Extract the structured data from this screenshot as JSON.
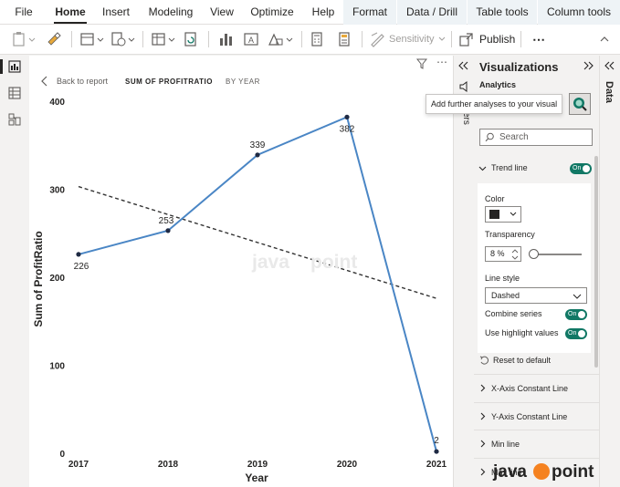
{
  "menu": {
    "items": [
      "File",
      "Home",
      "Insert",
      "Modeling",
      "View",
      "Optimize",
      "Help"
    ],
    "context_items": [
      "Format",
      "Data / Drill",
      "Table tools",
      "Column tools"
    ]
  },
  "toolbar": {
    "sensitivity_label": "Sensitivity",
    "publish_label": "Publish",
    "more_label": "⋯"
  },
  "canvas": {
    "back_label": "Back to report",
    "crumb_measure": "SUM OF PROFITRATIO",
    "crumb_axis": "BY YEAR"
  },
  "chart_data": {
    "type": "line",
    "categories": [
      "2017",
      "2018",
      "2019",
      "2020",
      "2021"
    ],
    "series": [
      {
        "values": [
          226,
          253,
          339,
          382,
          2
        ]
      }
    ],
    "data_labels": [
      "226",
      "253",
      "339",
      "382",
      "2"
    ],
    "trend_line": {
      "start": 303,
      "end": 176,
      "style": "dashed"
    },
    "xlabel": "Year",
    "ylabel": "Sum of ProfitRatio",
    "ylim": [
      0,
      400
    ],
    "yticks": [
      "400",
      "300",
      "200",
      "100",
      "0"
    ],
    "line_color": "#4a86c5",
    "trend_color": "#333333"
  },
  "strip": {
    "label": "ers"
  },
  "viz_panel": {
    "title": "Visualizations",
    "analytics_label": "Analytics",
    "tooltip": "Add further analyses to your visual",
    "search_placeholder": "Search",
    "trend_section": "Trend line",
    "trend_toggle": "On",
    "color_label": "Color",
    "transparency_label": "Transparency",
    "transparency_value": "8 %",
    "line_style_label": "Line style",
    "line_style_value": "Dashed",
    "combine_label": "Combine series",
    "combine_toggle": "On",
    "highlight_label": "Use highlight values",
    "highlight_toggle": "On",
    "reset_label": "Reset to default",
    "sections": [
      "X-Axis Constant Line",
      "Y-Axis Constant Line",
      "Min line",
      "Max line"
    ]
  },
  "data_panel": {
    "label": "Data"
  },
  "watermark": {
    "left": "java",
    "right": "point"
  },
  "colors": {
    "accent": "#117865",
    "ribbon_context": "#eef3f6",
    "brand_orange": "#f58220"
  }
}
